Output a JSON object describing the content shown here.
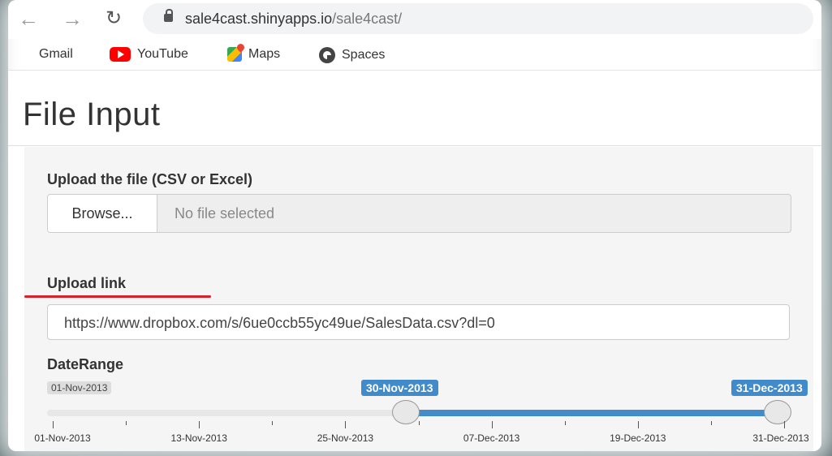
{
  "browser": {
    "url_host": "sale4cast.shinyapps.io",
    "url_path": "/sale4cast/"
  },
  "bookmarks": [
    {
      "label": "Gmail",
      "icon": "gmail-icon"
    },
    {
      "label": "YouTube",
      "icon": "youtube-icon"
    },
    {
      "label": "Maps",
      "icon": "maps-icon"
    },
    {
      "label": "Spaces",
      "icon": "spaces-icon"
    }
  ],
  "page": {
    "title": "File Input",
    "file_upload": {
      "label": "Upload the file (CSV or Excel)",
      "browse_label": "Browse...",
      "status": "No file selected"
    },
    "upload_link": {
      "label": "Upload link",
      "value": "https://www.dropbox.com/s/6ue0ccb55yc49ue/SalesData.csv?dl=0"
    },
    "date_range": {
      "label": "DateRange",
      "min": "01-Nov-2013",
      "from": "30-Nov-2013",
      "to": "31-Dec-2013",
      "tick_labels": [
        "01-Nov-2013",
        "13-Nov-2013",
        "25-Nov-2013",
        "07-Dec-2013",
        "19-Dec-2013",
        "31-Dec-2013"
      ]
    }
  },
  "colors": {
    "accent": "#428bca",
    "annotation_underline": "#d9202c"
  }
}
